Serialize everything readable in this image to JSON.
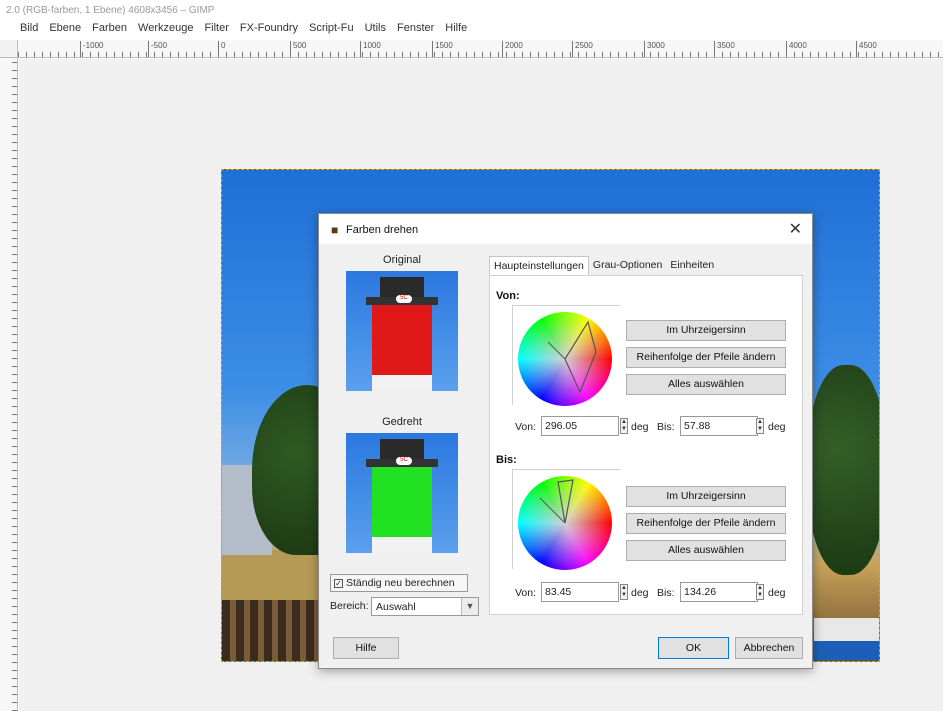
{
  "window": {
    "title": "2.0 (RGB-farben, 1 Ebene) 4608x3456 – GIMP"
  },
  "menu": [
    "Bild",
    "Ebene",
    "Farben",
    "Werkzeuge",
    "Filter",
    "FX-Foundry",
    "Script-Fu",
    "Utils",
    "Fenster",
    "Hilfe"
  ],
  "ruler": {
    "top_labels": [
      "-1000",
      "-500",
      "0",
      "500",
      "1000",
      "1500",
      "2000",
      "2500",
      "3000",
      "3500",
      "4000",
      "4500"
    ]
  },
  "dialog": {
    "title": "Farben drehen",
    "icon": "gimp-wilber-icon",
    "close": "✕",
    "preview_original_label": "Original",
    "preview_rotated_label": "Gedreht",
    "tower_sign": "5C",
    "checkbox_label": "Ständig neu berechnen",
    "checkbox_checked": true,
    "area_label": "Bereich:",
    "area_value": "Auswahl",
    "tabs": [
      "Haupteinstellungen",
      "Grau-Optionen",
      "Einheiten"
    ],
    "active_tab": 0,
    "from_section": {
      "heading": "Von:",
      "btn_clockwise": "Im Uhrzeigersinn",
      "btn_swap": "Reihenfolge der Pfeile ändern",
      "btn_select_all": "Alles auswählen",
      "from_label": "Von:",
      "from_value": "296.05",
      "unit1": "deg",
      "to_label": "Bis:",
      "to_value": "57.88",
      "unit2": "deg"
    },
    "to_section": {
      "heading": "Bis:",
      "btn_clockwise": "Im Uhrzeigersinn",
      "btn_swap": "Reihenfolge der Pfeile ändern",
      "btn_select_all": "Alles auswählen",
      "from_label": "Von:",
      "from_value": "83.45",
      "unit1": "deg",
      "to_label": "Bis:",
      "to_value": "134.26",
      "unit2": "deg"
    },
    "help_button": "Hilfe",
    "ok_button": "OK",
    "cancel_button": "Abbrechen"
  },
  "colors": {
    "original_tower": "#e01818",
    "rotated_tower": "#22e022",
    "default_button_border": "#0078d7"
  }
}
